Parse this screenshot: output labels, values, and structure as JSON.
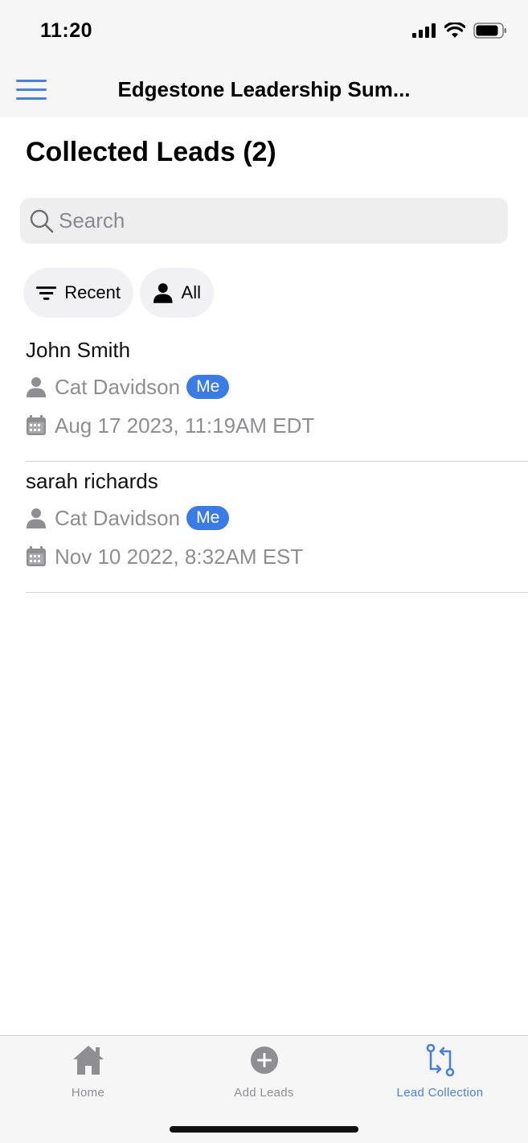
{
  "status": {
    "time": "11:20"
  },
  "nav": {
    "title": "Edgestone Leadership Sum..."
  },
  "page": {
    "title": "Collected Leads (2)"
  },
  "search": {
    "placeholder": "Search"
  },
  "filters": {
    "sort_label": "Recent",
    "scope_label": "All"
  },
  "leads": [
    {
      "name": "John Smith",
      "owner": "Cat Davidson",
      "badge": "Me",
      "date": "Aug 17 2023, 11:19AM EDT"
    },
    {
      "name": "sarah richards",
      "owner": "Cat Davidson",
      "badge": "Me",
      "date": "Nov 10 2022, 8:32AM EST"
    }
  ],
  "tabs": [
    {
      "label": "Home",
      "icon": "home-icon",
      "active": false
    },
    {
      "label": "Add Leads",
      "icon": "plus-circle-icon",
      "active": false
    },
    {
      "label": "Lead Collection",
      "icon": "lead-collection-icon",
      "active": true
    }
  ],
  "colors": {
    "accent": "#4a80d9",
    "badge": "#3a7be6",
    "secondary_text": "#8e8e93"
  }
}
